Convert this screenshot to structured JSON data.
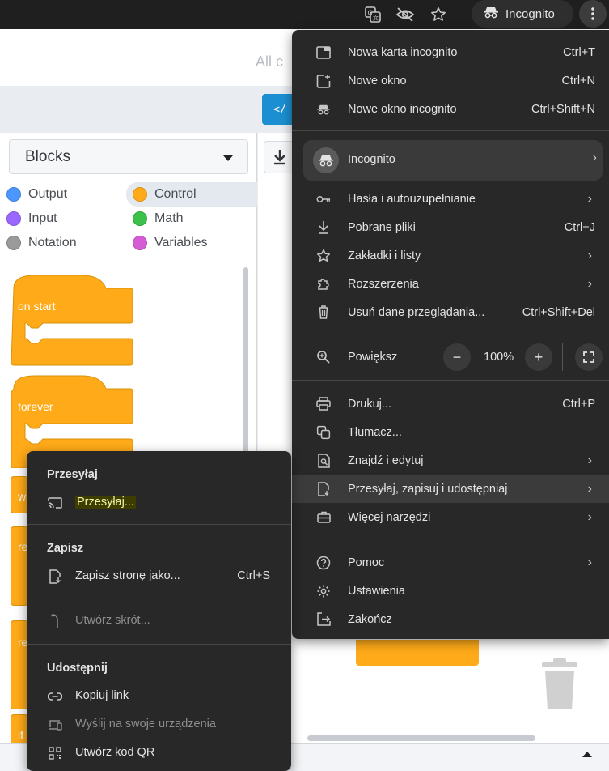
{
  "browser": {
    "profile_pill_label": "Incognito",
    "icons": [
      "translate-icon",
      "eye-off-icon",
      "star-icon",
      "incognito-icon",
      "more-vert-icon"
    ]
  },
  "page": {
    "search_placeholder_fragment": "All c",
    "blocks_select_label": "Blocks",
    "categories": [
      {
        "label": "Output",
        "color": "#4c97ff"
      },
      {
        "label": "Control",
        "color": "#ffab19"
      },
      {
        "label": "Input",
        "color": "#9966ff"
      },
      {
        "label": "Math",
        "color": "#3cc24b"
      },
      {
        "label": "Notation",
        "color": "#9a9a9a"
      },
      {
        "label": "Variables",
        "color": "#d65cd6"
      }
    ],
    "blocks": [
      "on start",
      "forever",
      "w",
      "re",
      "re",
      "if"
    ]
  },
  "menu": {
    "items": [
      {
        "label": "Nowa karta incognito",
        "shortcut": "Ctrl+T",
        "icon": "new-tab-icon"
      },
      {
        "label": "Nowe okno",
        "shortcut": "Ctrl+N",
        "icon": "new-window-icon"
      },
      {
        "label": "Nowe okno incognito",
        "shortcut": "Ctrl+Shift+N",
        "icon": "incognito-icon"
      },
      {
        "label": "Hasła i autouzupełnianie",
        "icon": "key-icon"
      },
      {
        "label": "Pobrane pliki",
        "shortcut": "Ctrl+J",
        "icon": "download-icon"
      },
      {
        "label": "Zakładki i listy",
        "icon": "star-icon"
      },
      {
        "label": "Rozszerzenia",
        "icon": "extension-icon"
      },
      {
        "label": "Usuń dane przeglądania...",
        "shortcut": "Ctrl+Shift+Del",
        "icon": "trash-icon"
      },
      {
        "label": "Drukuj...",
        "shortcut": "Ctrl+P",
        "icon": "print-icon"
      },
      {
        "label": "Tłumacz...",
        "icon": "translate-icon"
      },
      {
        "label": "Znajdź i edytuj",
        "icon": "find-icon"
      },
      {
        "label": "Przesyłaj, zapisuj i udostępniaj",
        "icon": "cast-save-icon"
      },
      {
        "label": "Więcej narzędzi",
        "icon": "toolbox-icon"
      },
      {
        "label": "Pomoc",
        "icon": "help-icon"
      },
      {
        "label": "Ustawienia",
        "icon": "settings-icon"
      },
      {
        "label": "Zakończ",
        "icon": "exit-icon"
      }
    ],
    "profile_label": "Incognito",
    "zoom_label": "Powiększ",
    "zoom_value": "100%",
    "zoom_minus": "−",
    "zoom_plus": "+"
  },
  "submenu": {
    "section_cast": "Przesyłaj",
    "cast_item": "Przesyłaj...",
    "section_save": "Zapisz",
    "save_page": "Zapisz stronę jako...",
    "save_page_shortcut": "Ctrl+S",
    "create_shortcut": "Utwórz skrót...",
    "section_share": "Udostępnij",
    "copy_link": "Kopiuj link",
    "send_to_devices": "Wyślij na swoje urządzenia",
    "create_qr": "Utwórz kod QR"
  }
}
